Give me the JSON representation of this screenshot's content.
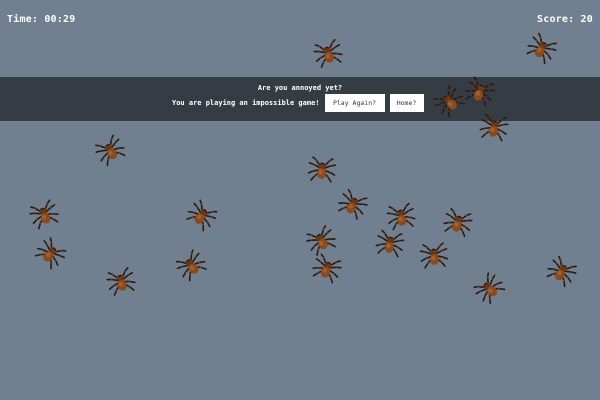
{
  "hud": {
    "time": "Time: 00:29",
    "score": "Score: 20"
  },
  "overlay": {
    "question": "Are you annoyed yet?",
    "message": "You are playing an impossible game!",
    "play_again_label": "Play Again?",
    "home_label": "Home?"
  },
  "colors": {
    "background": "#708090",
    "overlay": "#363c43",
    "spider_body": "#8a4a1c",
    "spider_legs": "#2a1a10"
  },
  "sprite_icon": "tarantula-icon"
}
